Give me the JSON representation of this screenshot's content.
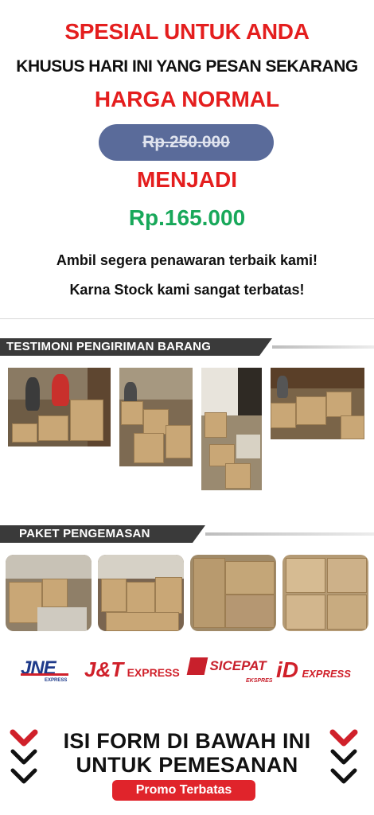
{
  "promo": {
    "title": "SPESIAL UNTUK ANDA",
    "subtitle": "KHUSUS HARI INI YANG PESAN SEKARANG",
    "normal_label": "HARGA NORMAL",
    "old_price": "Rp.250.000",
    "becomes_label": "MENJADI",
    "new_price": "Rp.165.000",
    "line1": "Ambil segera penawaran terbaik kami!",
    "line2": "Karna Stock kami sangat terbatas!",
    "colors": {
      "accent_red": "#e41e1e",
      "price_green": "#18a85a",
      "pill": "#5a6b9a"
    }
  },
  "sections": {
    "testimoni_title": "TESTIMONI PENGIRIMAN BARANG",
    "paket_title": "PAKET PENGEMASAN"
  },
  "couriers": {
    "jne": "JNE",
    "jne_sub": "EXPRESS",
    "jnt": "J&T",
    "jnt_sub": "EXPRESS",
    "sicepat": "SICEPAT",
    "sicepat_sub": "EKSPRES",
    "idx": "iD",
    "idx_sub": "EXPRESS"
  },
  "cta": {
    "line1": "ISI FORM DI BAWAH INI",
    "line2": "UNTUK PEMESANAN",
    "badge": "Promo Terbatas",
    "icons": [
      "chevron-down-icon",
      "chevron-down-icon"
    ]
  }
}
